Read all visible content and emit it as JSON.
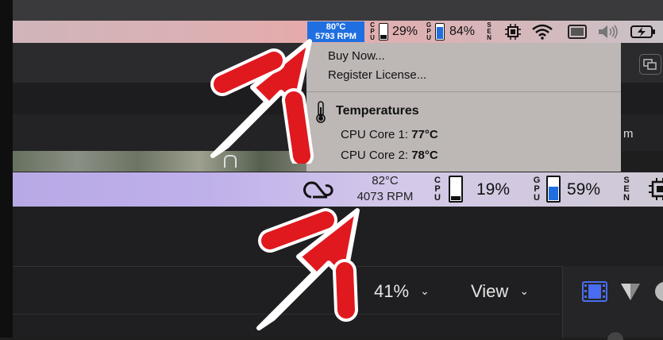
{
  "menubar_top": {
    "temperature": "80°C",
    "fan_speed": "5793 RPM",
    "cpu_label": [
      "C",
      "P",
      "U"
    ],
    "cpu_percent": "29%",
    "cpu_level": 0.29,
    "gpu_label": [
      "G",
      "P",
      "U"
    ],
    "gpu_percent": "84%",
    "gpu_level": 0.84,
    "sen_label": [
      "S",
      "E",
      "N"
    ],
    "icons": [
      "chip-icon",
      "wifi-icon",
      "display-icon",
      "volume-icon",
      "battery-charging-icon"
    ]
  },
  "dropdown": {
    "items": [
      "Buy Now...",
      "Register License..."
    ],
    "section_title": "Temperatures",
    "readings": [
      {
        "label": "CPU Core 1: ",
        "value": "77°C"
      },
      {
        "label": "CPU Core 2: ",
        "value": "78°C"
      }
    ]
  },
  "menubar_bottom": {
    "temperature": "82°C",
    "fan_speed": "4073 RPM",
    "cpu_label": [
      "C",
      "P",
      "U"
    ],
    "cpu_percent": "19%",
    "cpu_level": 0.19,
    "gpu_label": [
      "G",
      "P",
      "U"
    ],
    "gpu_percent": "59%",
    "gpu_level": 0.59,
    "sen_label": [
      "S",
      "E",
      "N"
    ]
  },
  "app_toolbar": {
    "zoom": "41%",
    "view": "View",
    "partial_text": "m"
  },
  "colors": {
    "arrow": "#e0191f",
    "highlight": "#1f6fe0",
    "gpu_fill": "#1f6fe0"
  }
}
